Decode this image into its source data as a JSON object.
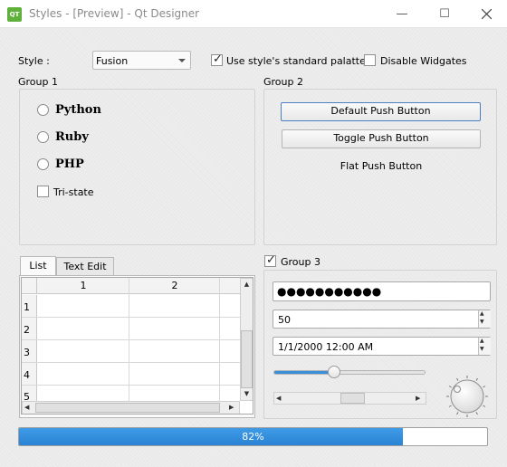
{
  "window": {
    "title": "Styles - [Preview] - Qt Designer",
    "app_icon_text": "QT",
    "minimize_glyph": "—",
    "maximize_glyph": "☐"
  },
  "style_row": {
    "style_label": "Style :",
    "style_value": "Fusion",
    "use_palette_label": "Use style's standard palatte",
    "use_palette_checked": true,
    "disable_widgets_label": "Disable Widgates",
    "disable_widgets_checked": false
  },
  "group1": {
    "title": "Group 1",
    "radios": [
      "Python",
      "Ruby",
      "PHP"
    ],
    "tristate_label": "Tri-state"
  },
  "group2": {
    "title": "Group 2",
    "default_button": "Default Push Button",
    "toggle_button": "Toggle Push Button",
    "flat_button": "Flat Push Button"
  },
  "tabs": {
    "list_label": "List",
    "textedit_label": "Text Edit",
    "active": "List"
  },
  "table": {
    "columns": [
      "1",
      "2"
    ],
    "rows": [
      "1",
      "2",
      "3",
      "4",
      "5"
    ]
  },
  "group3": {
    "title": "Group 3",
    "checked": true,
    "password_value": "●●●●●●●●●●●",
    "spin_value": "50",
    "datetime_value": "1/1/2000 12:00 AM",
    "slider_value_fraction": 0.4,
    "scrollbar_value_fraction": 0.5
  },
  "progress": {
    "value_percent": 82,
    "text": "82%"
  },
  "colors": {
    "progress_fill": "#2a83d4",
    "default_button_border": "#4a7fc1",
    "app_icon": "#5fb13b"
  },
  "icons": {
    "combo_arrow": "chevron-down-icon",
    "spin_up": "triangle-up-icon",
    "spin_down": "triangle-down-icon",
    "window_close": "close-icon"
  }
}
